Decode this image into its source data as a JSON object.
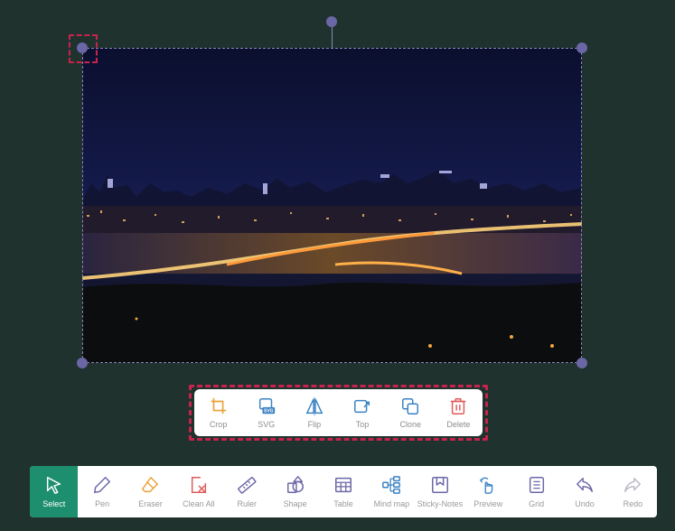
{
  "context_toolbar": {
    "items": [
      {
        "label": "Crop",
        "icon": "crop-icon"
      },
      {
        "label": "SVG",
        "icon": "svg-export-icon",
        "badge": "SVG"
      },
      {
        "label": "Flip",
        "icon": "flip-icon"
      },
      {
        "label": "Top",
        "icon": "bring-to-top-icon"
      },
      {
        "label": "Clone",
        "icon": "clone-icon"
      },
      {
        "label": "Delete",
        "icon": "trash-icon"
      }
    ]
  },
  "toolbar": {
    "active": "Select",
    "items": [
      {
        "label": "Select",
        "icon": "cursor-icon"
      },
      {
        "label": "Pen",
        "icon": "pen-icon"
      },
      {
        "label": "Eraser",
        "icon": "eraser-icon"
      },
      {
        "label": "Clean All",
        "icon": "clean-all-icon"
      },
      {
        "label": "Ruler",
        "icon": "ruler-icon"
      },
      {
        "label": "Shape",
        "icon": "shape-icon"
      },
      {
        "label": "Table",
        "icon": "table-icon"
      },
      {
        "label": "Mind map",
        "icon": "mind-map-icon"
      },
      {
        "label": "Sticky-Notes",
        "icon": "sticky-note-icon"
      },
      {
        "label": "Preview",
        "icon": "preview-hand-icon"
      },
      {
        "label": "Grid",
        "icon": "grid-icon"
      },
      {
        "label": "Undo",
        "icon": "undo-icon"
      },
      {
        "label": "Redo",
        "icon": "redo-icon"
      }
    ]
  },
  "colors": {
    "background": "#1f322e",
    "accent": "#1e8f6e",
    "selection_handle": "#6b66a6",
    "highlight": "#c8234d",
    "context_icon_blue": "#3b82c4",
    "context_icon_orange": "#e8a33a",
    "delete_icon": "#e05a5a"
  }
}
